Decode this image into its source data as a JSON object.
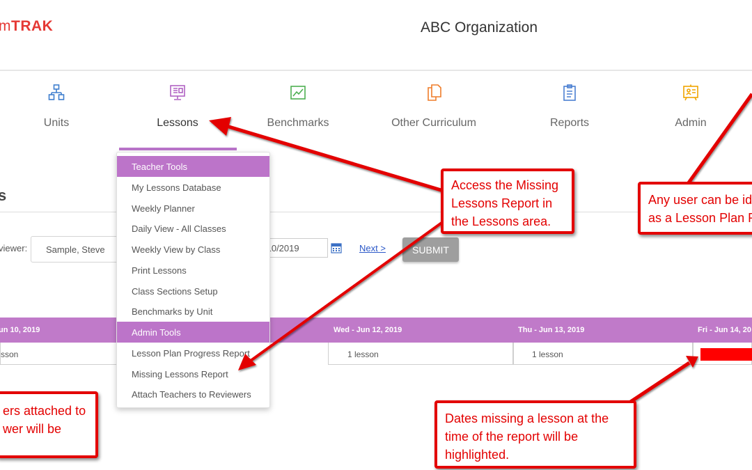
{
  "header": {
    "logo_prefix": "m",
    "logo_bold": "TRAK",
    "org_title": "ABC Organization"
  },
  "nav": {
    "items": [
      {
        "label": "Units",
        "icon": "sitemap-icon"
      },
      {
        "label": "Lessons",
        "icon": "presentation-icon"
      },
      {
        "label": "Benchmarks",
        "icon": "line-chart-icon"
      },
      {
        "label": "Other Curriculum",
        "icon": "documents-icon"
      },
      {
        "label": "Reports",
        "icon": "clipboard-icon"
      },
      {
        "label": "Admin",
        "icon": "admin-board-icon"
      }
    ],
    "active": "Lessons"
  },
  "page": {
    "heading": "s"
  },
  "filters": {
    "reviewer_label": "viewer:",
    "reviewer_value": "Sample, Steve",
    "date_value": "/10/2019",
    "next_label": "Next >",
    "submit_label": "SUBMIT"
  },
  "week_grid": {
    "days": [
      {
        "header": "un 10, 2019",
        "cell": "sson"
      },
      {
        "header": "Wed - Jun 12, 2019",
        "cell": "1 lesson"
      },
      {
        "header": "Thu - Jun 13, 2019",
        "cell": "1 lesson"
      },
      {
        "header": "Fri - Jun 14, 20",
        "cell": ""
      }
    ]
  },
  "dropdown": {
    "teacher_header": "Teacher Tools",
    "teacher_items": [
      "My Lessons Database",
      "Weekly Planner",
      "Daily View - All Classes",
      "Weekly View by Class",
      "Print Lessons",
      "Class Sections Setup",
      "Benchmarks by Unit"
    ],
    "admin_header": "Admin Tools",
    "admin_items": [
      "Lesson Plan Progress Report",
      "Missing Lessons Report",
      "Attach Teachers to Reviewers"
    ]
  },
  "callouts": {
    "access": [
      "Access the Missing",
      "Lessons Report in",
      "the Lessons area."
    ],
    "any_user": [
      "Any user can be id",
      "as a Lesson Plan R"
    ],
    "teachers": [
      "ers attached to",
      "wer will be"
    ],
    "dates": [
      "Dates missing a lesson at the",
      "time of the report will be",
      "highlighted."
    ]
  },
  "colors": {
    "accent_purple": "#c07ac9",
    "callout_red": "#e30000",
    "logo_red": "#e53935",
    "missing_highlight": "#ff0000"
  }
}
